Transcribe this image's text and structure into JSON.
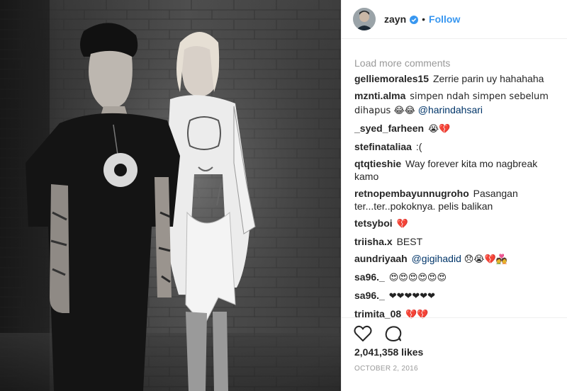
{
  "header": {
    "username": "zayn",
    "separator": "•",
    "follow_label": "Follow",
    "verified_color": "#3897f0"
  },
  "comments": {
    "load_more_label": "Load more comments",
    "items": [
      {
        "user": "gelliemorales15",
        "text": "Zerrie parin uy hahahaha"
      },
      {
        "user": "mznti.alma",
        "text": "simpen ndah simpen sebelum dihapus 😂😂",
        "mention": "@harindahsari"
      },
      {
        "user": "_syed_farheen",
        "text": "😭💔"
      },
      {
        "user": "stefinataliaa",
        "text": ":("
      },
      {
        "user": "qtqtieshie",
        "text": "Way forever kita mo nagbreak kamo"
      },
      {
        "user": "retnopembayunnugroho",
        "text": "Pasangan ter...ter..pokoknya. pelis balikan"
      },
      {
        "user": "tetsyboi",
        "text": "💔"
      },
      {
        "user": "triisha.x",
        "text": "BEST"
      },
      {
        "user": "aundriyaah",
        "mention": "@gigihadid",
        "text": "😞😭💔💑"
      },
      {
        "user": "sa96._",
        "text": "😍😍😍😍😍😍"
      },
      {
        "user": "sa96._",
        "text": "❤❤❤❤❤❤"
      },
      {
        "user": "trimita_08",
        "text": "💔💔"
      }
    ]
  },
  "footer": {
    "likes": "2,041,358 likes",
    "date": "OCTOBER 2, 2016"
  },
  "icons": {
    "like": "heart-icon",
    "comment": "comment-bubble-icon",
    "verified": "verified-badge-icon"
  },
  "colors": {
    "link": "#3897f0",
    "mention": "#003569",
    "muted": "#999999",
    "text": "#262626"
  }
}
